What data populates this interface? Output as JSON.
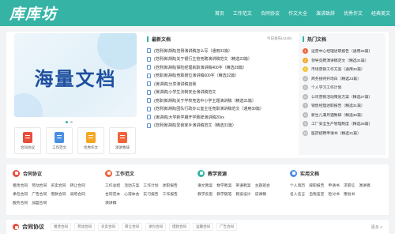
{
  "site": {
    "logo": "库库坊"
  },
  "nav": [
    "首页",
    "工作范文",
    "合同协议",
    "作文大全",
    "演讲致辞",
    "优秀作文",
    "经典美文"
  ],
  "banner": {
    "title": "海量文档",
    "subtitle": ""
  },
  "quick": [
    {
      "label": "合同协议",
      "color": "#e94e3c"
    },
    {
      "label": "工作范文",
      "color": "#4a90e2"
    },
    {
      "label": "优秀作文",
      "color": "#f5a623"
    },
    {
      "label": "演讲致辞",
      "color": "#f0643a"
    }
  ],
  "latest": {
    "title": "最新文档",
    "more": "今日发布(4140)",
    "items": [
      "(范例演讲稿)范例演讲稿怎么写（通用31篇）",
      "(范例演讲稿)关于银行主管竞聘演讲稿范文（精选23篇）",
      "(范例演讲稿)保险经理就职演讲稿400字（精选28篇）",
      "(竞职演讲稿)竞职岗位演讲稿600字（精选32篇）",
      "(演讲稿)分享演讲稿自我",
      "(演讲稿)小学生法制安全演讲稿范文",
      "(竞职演讲稿)关于学校竞选中小学主题演讲稿（精选31篇）",
      "(范例演讲稿)团队行政办公室主任竞职演讲稿范文（通用30篇）",
      "(演讲稿)大学新学期开学致辞演讲稿20xx",
      "(范例演讲稿)爱我家乡演讲稿范文（精选31篇）"
    ]
  },
  "hot": {
    "title": "热门文档",
    "items": [
      "运营中心经理述职报告（通用25篇）",
      "领导竞聘演讲稿范文（精选31篇）",
      "市场营销工作方案（通用32篇）",
      "商务接待开场白（精选23篇）",
      "个人学习工作计划",
      "公司营销活动策划方案（精选27篇）",
      "销售经理述职报告（精选31篇）",
      "新生儿满月酒致辞（精选30篇）",
      "工厂安全生产管理制度（精选28篇）",
      "医药招聘申请书（精选31篇）"
    ]
  },
  "categories": [
    {
      "title": "合同协议",
      "color": "#e94e3c",
      "links": [
        "租赁合同",
        "劳动合同",
        "买卖合同",
        "转让合同",
        "承包合同",
        "广告合同",
        "借款合同",
        "采购合同",
        "服务合同",
        "加盟合同"
      ]
    },
    {
      "title": "工作范文",
      "color": "#f0643a",
      "links": [
        "工作总结",
        "活动方案",
        "工作计划",
        "述职报告",
        "合同范本",
        "心得体会",
        "实习报告",
        "工作报告",
        "演讲稿"
      ]
    },
    {
      "title": "教学资源",
      "color": "#35b3a5",
      "links": [
        "语文教案",
        "数学教案",
        "英语教案",
        "主题班会",
        "教学反思",
        "教学随笔",
        "教案设计",
        "说课稿"
      ]
    },
    {
      "title": "实用文档",
      "color": "#4a90e2",
      "links": [
        "个人简历",
        "辞职报告",
        "申请书",
        "求职信",
        "演讲稿",
        "名人名言",
        "自我鉴定",
        "检讨书",
        "策划书"
      ]
    }
  ],
  "bottom": {
    "title": "合同协议",
    "tags": [
      "租赁合同",
      "劳动合同",
      "买卖合同",
      "转让合同",
      "承包合同",
      "借款合同",
      "运输合同",
      "广告合同"
    ],
    "more": "更多 >"
  }
}
